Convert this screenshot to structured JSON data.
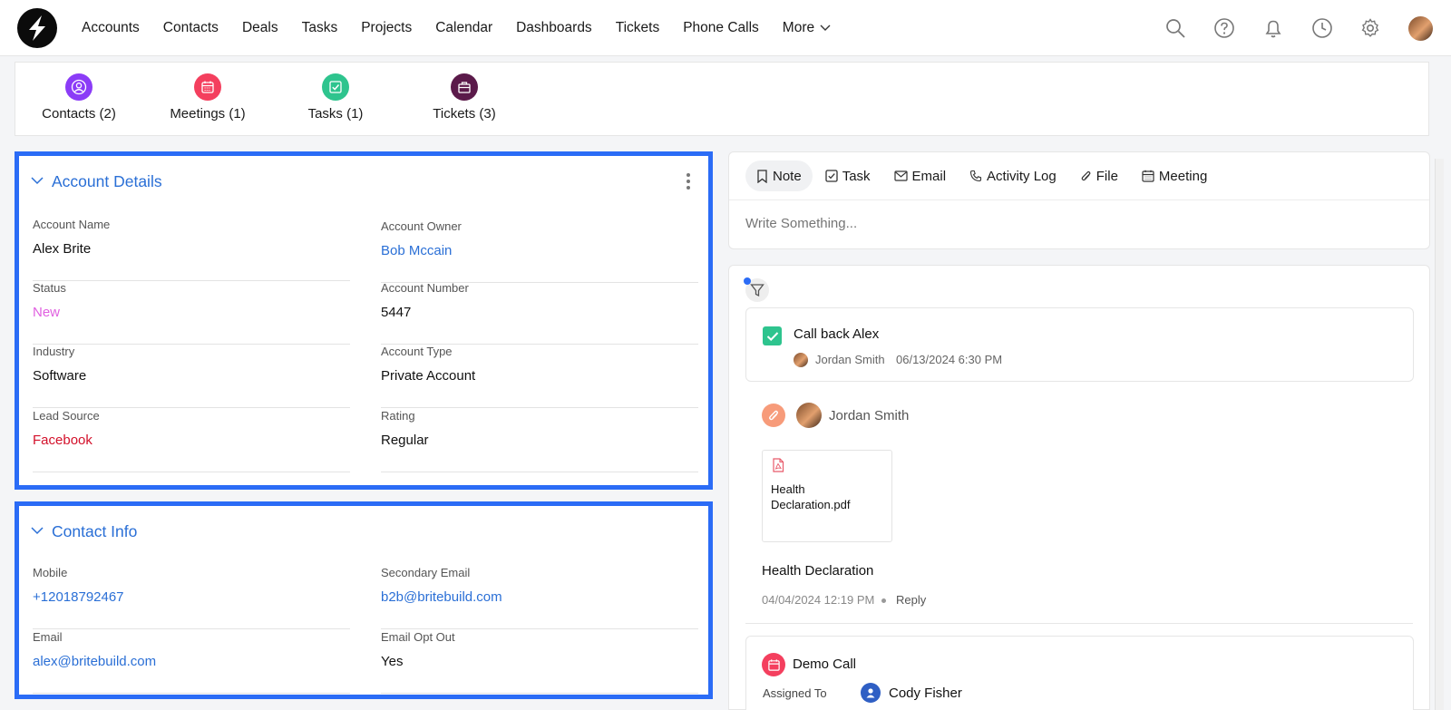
{
  "nav": {
    "items": [
      "Accounts",
      "Contacts",
      "Deals",
      "Tasks",
      "Projects",
      "Calendar",
      "Dashboards",
      "Tickets",
      "Phone Calls"
    ],
    "more_label": "More",
    "icons": [
      "search-icon",
      "help-icon",
      "bell-icon",
      "clock-icon",
      "gear-icon",
      "avatar"
    ]
  },
  "related": [
    {
      "label": "Contacts (2)",
      "icon": "contacts-icon",
      "color": "#8b3cf7"
    },
    {
      "label": "Meetings (1)",
      "icon": "calendar-icon",
      "color": "#f43f5e"
    },
    {
      "label": "Tasks (1)",
      "icon": "task-check-icon",
      "color": "#2ec48e"
    },
    {
      "label": "Tickets (3)",
      "icon": "ticket-icon",
      "color": "#5b1a4a"
    }
  ],
  "account_details": {
    "title": "Account Details",
    "fields": [
      {
        "label": "Account Name",
        "value": "Alex Brite"
      },
      {
        "label": "Account Owner",
        "value": "Bob Mccain"
      },
      {
        "label": "Status",
        "value": "New"
      },
      {
        "label": "Account Number",
        "value": "5447"
      },
      {
        "label": "Industry",
        "value": "Software"
      },
      {
        "label": "Account Type",
        "value": "Private Account"
      },
      {
        "label": "Lead Source",
        "value": "Facebook"
      },
      {
        "label": "Rating",
        "value": "Regular"
      }
    ]
  },
  "contact_info": {
    "title": "Contact Info",
    "fields": [
      {
        "label": "Mobile",
        "value": "+12018792467"
      },
      {
        "label": "Secondary Email",
        "value": "b2b@britebuild.com"
      },
      {
        "label": "Email",
        "value": "alex@britebuild.com"
      },
      {
        "label": "Email Opt Out",
        "value": "Yes"
      }
    ]
  },
  "composer": {
    "tabs": [
      "Note",
      "Task",
      "Email",
      "Activity Log",
      "File",
      "Meeting"
    ],
    "placeholder": "Write Something..."
  },
  "timeline": {
    "task": {
      "title": "Call back Alex",
      "user": "Jordan Smith",
      "datetime": "06/13/2024 6:30 PM"
    },
    "file": {
      "user": "Jordan Smith",
      "file_name": "Health Declaration.pdf",
      "file_line1": "Health",
      "file_line2": "Declaration.pdf",
      "title": "Health Declaration",
      "datetime": "04/04/2024 12:19 PM",
      "reply_label": "Reply"
    },
    "meeting": {
      "title": "Demo Call",
      "assigned_label": "Assigned To",
      "assignee": "Cody Fisher"
    }
  },
  "colors": {
    "accent": "#2a6fd6",
    "highlight_border": "#2b6cf6",
    "status_new": "#e060e0",
    "lead_source": "#d3102a"
  }
}
